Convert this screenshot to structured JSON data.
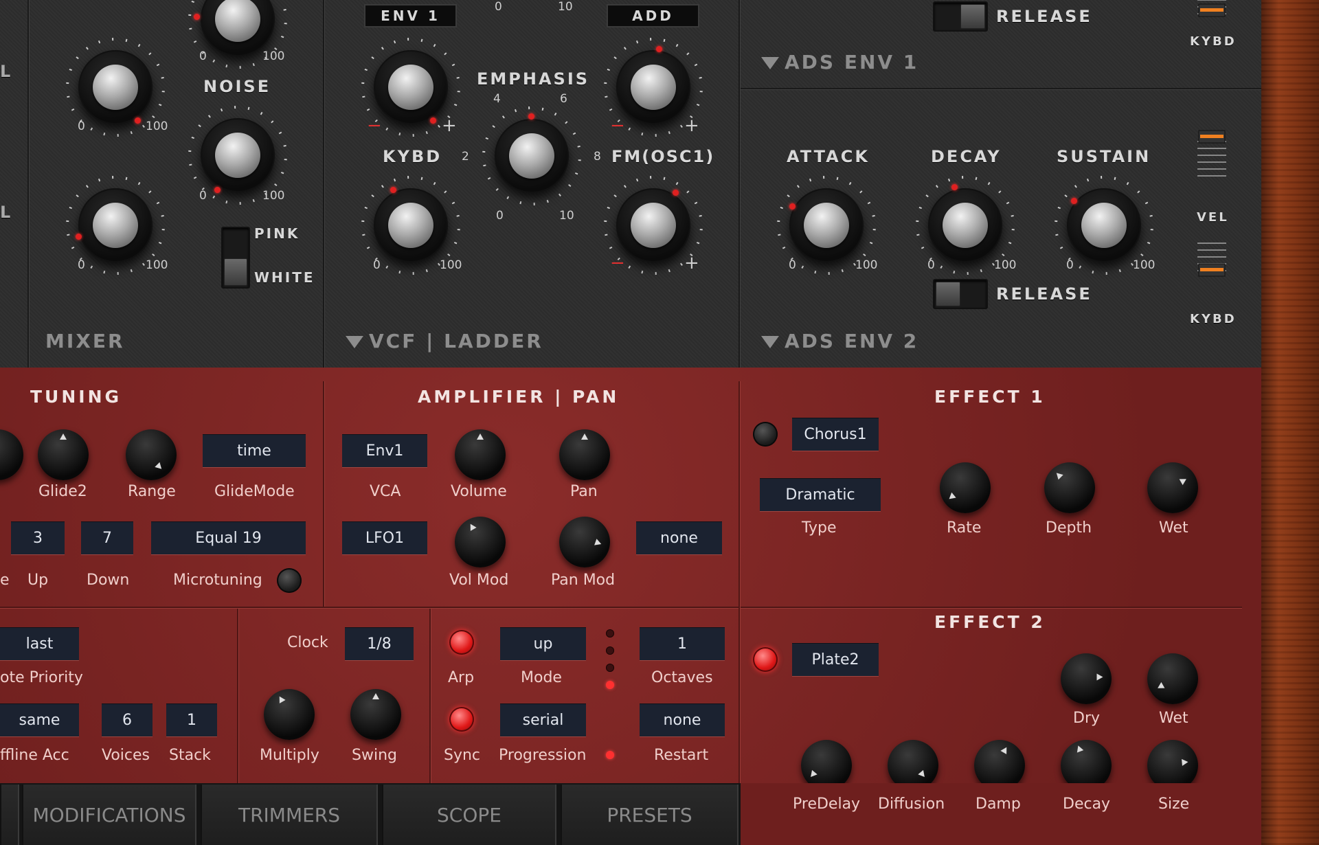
{
  "top": {
    "mixer": {
      "title": "MIXER"
    },
    "noise": {
      "title": "NOISE",
      "pink": "PINK",
      "white": "WHITE"
    },
    "vcf": {
      "title": "VCF",
      "subtitle": "LADDER",
      "env_lcd": "ENV 1",
      "add_lcd": "ADD",
      "emphasis": "EMPHASIS",
      "kybd": "KYBD",
      "fm": "FM(OSC1)"
    },
    "ads1": {
      "title": "ADS ENV 1",
      "release": "RELEASE",
      "kybd": "KYBD"
    },
    "ads2": {
      "title": "ADS ENV 2",
      "attack": "ATTACK",
      "decay": "DECAY",
      "sustain": "SUSTAIN",
      "release": "RELEASE",
      "vel": "VEL",
      "kybd": "KYBD"
    },
    "scale": {
      "min": "0",
      "max": "100",
      "s2": "2",
      "s4": "4",
      "s6": "6",
      "s8": "8",
      "s10": "10",
      "minus": "−",
      "plus": "+"
    }
  },
  "tuning": {
    "title": "TUNING",
    "glide2": "Glide2",
    "range": "Range",
    "glidemode_value": "time",
    "glidemode": "GlideMode",
    "up_value": "3",
    "up": "Up",
    "down_value": "7",
    "down": "Down",
    "left_cut": "e",
    "micro_value": "Equal 19",
    "microtuning": "Microtuning"
  },
  "amp": {
    "title": "AMPLIFIER | PAN",
    "vca_value": "Env1",
    "vca": "VCA",
    "volume": "Volume",
    "pan": "Pan",
    "volmod_src": "LFO1",
    "volmod": "Vol Mod",
    "panmod": "Pan Mod",
    "panmod_src": "none"
  },
  "voice": {
    "priority_value": "last",
    "priority": "ote Priority",
    "offline_value": "same",
    "offline": "ffline Acc",
    "voices_value": "6",
    "voices": "Voices",
    "stack_value": "1",
    "stack": "Stack"
  },
  "clock": {
    "label": "Clock",
    "value": "1/8",
    "multiply": "Multiply",
    "swing": "Swing"
  },
  "arp": {
    "arp": "Arp",
    "mode_value": "up",
    "mode": "Mode",
    "octaves_value": "1",
    "octaves": "Octaves",
    "sync": "Sync",
    "prog_value": "serial",
    "progression": "Progression",
    "restart_value": "none",
    "restart": "Restart"
  },
  "effect1": {
    "title": "EFFECT 1",
    "preset": "Chorus1",
    "type_value": "Dramatic",
    "type": "Type",
    "rate": "Rate",
    "depth": "Depth",
    "wet": "Wet"
  },
  "effect2": {
    "title": "EFFECT 2",
    "preset": "Plate2",
    "dry": "Dry",
    "wet": "Wet",
    "predelay": "PreDelay",
    "diffusion": "Diffusion",
    "damp": "Damp",
    "decay": "Decay",
    "size": "Size"
  },
  "tabs": [
    {
      "label": "MODIFICATIONS"
    },
    {
      "label": "TRIMMERS"
    },
    {
      "label": "SCOPE"
    },
    {
      "label": "PRESETS"
    }
  ]
}
